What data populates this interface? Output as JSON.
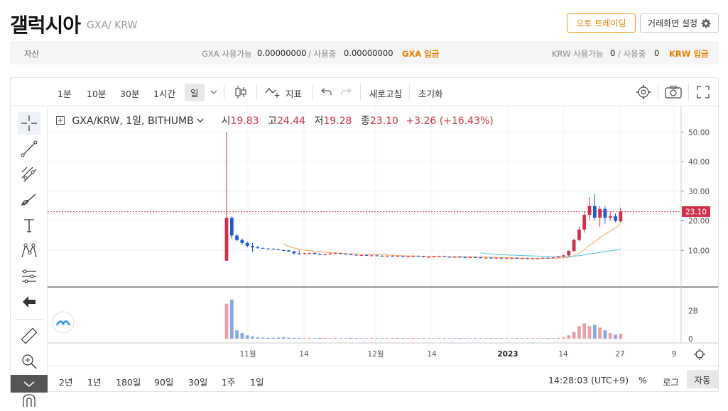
{
  "header": {
    "coin_name": "갤럭시아",
    "pair": "GXA/ KRW",
    "auto_trading": "오토 트레이딩",
    "trade_settings": "거래화면 설정"
  },
  "asset_bar": {
    "label": "자산",
    "gxa_available_label": "GXA 사용가능",
    "gxa_available": "0.00000000",
    "gxa_inuse_label": "/ 사용중",
    "gxa_inuse": "0.00000000",
    "gxa_deposit": "GXA 입금",
    "krw_available_label": "KRW 사용가능",
    "krw_available": "0",
    "krw_inuse_label": "/ 사용중",
    "krw_inuse": "0",
    "krw_deposit": "KRW 입금"
  },
  "toolbar": {
    "intervals": [
      "1분",
      "10분",
      "30분",
      "1시간",
      "일"
    ],
    "selected_interval": "일",
    "indicator": "지표",
    "refresh": "새로고침",
    "reset": "초기화"
  },
  "legend": {
    "symbol": "GXA/KRW, 1일, BITHUMB",
    "open_label": "시",
    "open": "19.83",
    "high_label": "고",
    "high": "24.44",
    "low_label": "저",
    "low": "19.28",
    "close_label": "종",
    "close": "23.10",
    "change": "+3.26 (+16.43%)"
  },
  "bottom_bar": {
    "ranges": [
      "2년",
      "1년",
      "180일",
      "90일",
      "30일",
      "1주",
      "1일"
    ],
    "time": "14:28:03 (UTC+9)",
    "percent": "%",
    "log": "로그",
    "auto": "자동"
  },
  "colors": {
    "up": "#d0304a",
    "down": "#1e5bd0",
    "accent": "#e67e00"
  },
  "chart_data": {
    "type": "candlestick",
    "current_price": "23.10",
    "y_ticks": [
      "50.00",
      "40.00",
      "30.00",
      "20.00",
      "10.00"
    ],
    "volume_ticks": [
      "2B",
      "0"
    ],
    "x_ticks": [
      "11월",
      "14",
      "12월",
      "14",
      "2023",
      "14",
      "27",
      "9"
    ],
    "ylim": [
      0,
      52
    ],
    "candles": [
      {
        "o": 6.5,
        "h": 50,
        "l": 6.5,
        "c": 21
      },
      {
        "o": 21,
        "h": 21.5,
        "l": 14,
        "c": 15
      },
      {
        "o": 15,
        "h": 15.5,
        "l": 13,
        "c": 13.5
      },
      {
        "o": 13.5,
        "h": 14,
        "l": 12,
        "c": 12.5
      },
      {
        "o": 12.5,
        "h": 13,
        "l": 11,
        "c": 11.5
      },
      {
        "o": 11.5,
        "h": 12.5,
        "l": 9.5,
        "c": 11
      },
      {
        "o": 11,
        "h": 11.5,
        "l": 10.5,
        "c": 10.8
      },
      {
        "o": 10.8,
        "h": 11,
        "l": 10.5,
        "c": 10.6
      },
      {
        "o": 10.6,
        "h": 10.8,
        "l": 10.3,
        "c": 10.5
      },
      {
        "o": 10.5,
        "h": 10.7,
        "l": 10.2,
        "c": 10.3
      },
      {
        "o": 10.3,
        "h": 10.5,
        "l": 10,
        "c": 10.1
      },
      {
        "o": 10.1,
        "h": 10.3,
        "l": 9.8,
        "c": 10.0
      },
      {
        "o": 10,
        "h": 10.2,
        "l": 9.5,
        "c": 9.6
      },
      {
        "o": 9.6,
        "h": 9.8,
        "l": 8.5,
        "c": 9.0
      },
      {
        "o": 9,
        "h": 10,
        "l": 8.5,
        "c": 8.8
      },
      {
        "o": 8.8,
        "h": 9.2,
        "l": 8.6,
        "c": 9.0
      },
      {
        "o": 9,
        "h": 9.3,
        "l": 8.8,
        "c": 9.1
      },
      {
        "o": 9.1,
        "h": 9.3,
        "l": 8.6,
        "c": 8.7
      },
      {
        "o": 8.7,
        "h": 9.0,
        "l": 8.3,
        "c": 8.5
      },
      {
        "o": 8.5,
        "h": 8.9,
        "l": 8.2,
        "c": 8.7
      },
      {
        "o": 8.7,
        "h": 9.1,
        "l": 8.5,
        "c": 8.9
      },
      {
        "o": 8.9,
        "h": 9.3,
        "l": 8.7,
        "c": 9.0
      },
      {
        "o": 9,
        "h": 9.2,
        "l": 8.7,
        "c": 8.8
      },
      {
        "o": 8.8,
        "h": 9.0,
        "l": 8.5,
        "c": 8.6
      },
      {
        "o": 8.6,
        "h": 8.9,
        "l": 8.4,
        "c": 8.5
      },
      {
        "o": 8.5,
        "h": 8.7,
        "l": 8.2,
        "c": 8.3
      },
      {
        "o": 8.3,
        "h": 8.6,
        "l": 8.1,
        "c": 8.4
      },
      {
        "o": 8.4,
        "h": 8.6,
        "l": 8.1,
        "c": 8.2
      },
      {
        "o": 8.2,
        "h": 8.5,
        "l": 8.0,
        "c": 8.3
      },
      {
        "o": 8.3,
        "h": 8.5,
        "l": 8.0,
        "c": 8.1
      },
      {
        "o": 8.1,
        "h": 8.4,
        "l": 7.9,
        "c": 8.0
      },
      {
        "o": 8,
        "h": 8.3,
        "l": 7.8,
        "c": 8.1
      },
      {
        "o": 8.1,
        "h": 8.3,
        "l": 7.8,
        "c": 7.9
      },
      {
        "o": 7.9,
        "h": 8.2,
        "l": 7.7,
        "c": 8.0
      },
      {
        "o": 8,
        "h": 8.2,
        "l": 7.7,
        "c": 7.8
      },
      {
        "o": 7.8,
        "h": 8.0,
        "l": 7.6,
        "c": 7.9
      },
      {
        "o": 7.9,
        "h": 8.3,
        "l": 7.7,
        "c": 8.1
      },
      {
        "o": 8.1,
        "h": 8.3,
        "l": 7.8,
        "c": 7.9
      },
      {
        "o": 7.9,
        "h": 8.1,
        "l": 7.6,
        "c": 7.7
      },
      {
        "o": 7.7,
        "h": 8.0,
        "l": 7.5,
        "c": 7.8
      },
      {
        "o": 7.8,
        "h": 8.1,
        "l": 7.6,
        "c": 7.9
      },
      {
        "o": 7.9,
        "h": 8.2,
        "l": 7.7,
        "c": 8.0
      },
      {
        "o": 8,
        "h": 8.2,
        "l": 7.7,
        "c": 7.8
      },
      {
        "o": 7.8,
        "h": 8.0,
        "l": 7.6,
        "c": 7.7
      },
      {
        "o": 7.7,
        "h": 8.0,
        "l": 7.5,
        "c": 7.8
      },
      {
        "o": 7.8,
        "h": 8.0,
        "l": 7.6,
        "c": 7.7
      },
      {
        "o": 7.7,
        "h": 7.9,
        "l": 7.4,
        "c": 7.6
      },
      {
        "o": 7.6,
        "h": 7.9,
        "l": 7.4,
        "c": 7.7
      },
      {
        "o": 7.7,
        "h": 7.9,
        "l": 7.5,
        "c": 7.6
      },
      {
        "o": 7.6,
        "h": 7.8,
        "l": 7.3,
        "c": 7.4
      },
      {
        "o": 7.4,
        "h": 7.7,
        "l": 7.2,
        "c": 7.5
      },
      {
        "o": 7.5,
        "h": 7.7,
        "l": 7.2,
        "c": 7.3
      },
      {
        "o": 7.3,
        "h": 7.6,
        "l": 7.1,
        "c": 7.4
      },
      {
        "o": 7.4,
        "h": 7.6,
        "l": 7.1,
        "c": 7.2
      },
      {
        "o": 7.2,
        "h": 7.5,
        "l": 7.0,
        "c": 7.3
      },
      {
        "o": 7.3,
        "h": 7.6,
        "l": 7.1,
        "c": 7.4
      },
      {
        "o": 7.4,
        "h": 7.6,
        "l": 7.1,
        "c": 7.2
      },
      {
        "o": 7.2,
        "h": 7.5,
        "l": 7.0,
        "c": 7.3
      },
      {
        "o": 7.3,
        "h": 7.5,
        "l": 7.0,
        "c": 7.1
      },
      {
        "o": 7.1,
        "h": 7.4,
        "l": 6.9,
        "c": 7.2
      },
      {
        "o": 7.2,
        "h": 7.5,
        "l": 7.0,
        "c": 7.3
      },
      {
        "o": 7.3,
        "h": 7.6,
        "l": 7.1,
        "c": 7.5
      },
      {
        "o": 7.5,
        "h": 7.8,
        "l": 7.2,
        "c": 7.4
      },
      {
        "o": 7.4,
        "h": 7.7,
        "l": 7.2,
        "c": 7.6
      },
      {
        "o": 7.6,
        "h": 8.0,
        "l": 7.4,
        "c": 7.9
      },
      {
        "o": 7.9,
        "h": 8.5,
        "l": 7.6,
        "c": 8.3
      },
      {
        "o": 8.3,
        "h": 10,
        "l": 8.0,
        "c": 9.8
      },
      {
        "o": 9.8,
        "h": 14,
        "l": 9.5,
        "c": 13.5
      },
      {
        "o": 13.5,
        "h": 18,
        "l": 13,
        "c": 17
      },
      {
        "o": 17,
        "h": 23,
        "l": 16,
        "c": 22
      },
      {
        "o": 22,
        "h": 28,
        "l": 20,
        "c": 25
      },
      {
        "o": 25,
        "h": 29,
        "l": 20,
        "c": 21
      },
      {
        "o": 21,
        "h": 25,
        "l": 18,
        "c": 24
      },
      {
        "o": 24,
        "h": 25,
        "l": 19,
        "c": 21
      },
      {
        "o": 21,
        "h": 23,
        "l": 20,
        "c": 21.5
      },
      {
        "o": 21.5,
        "h": 22.5,
        "l": 19.5,
        "c": 20
      },
      {
        "o": 19.83,
        "h": 24.44,
        "l": 19.28,
        "c": 23.1
      }
    ],
    "volumes": [
      1.25,
      1.4,
      0.3,
      0.2,
      0.12,
      0.08,
      0.05,
      0.04,
      0.03,
      0.03,
      0.04,
      0.05,
      0.04,
      0.03,
      0.03,
      0.02,
      0.03,
      0.02,
      0.03,
      0.03,
      0.02,
      0.03,
      0.02,
      0.02,
      0.03,
      0.02,
      0.02,
      0.02,
      0.03,
      0.02,
      0.02,
      0.02,
      0.02,
      0.03,
      0.02,
      0.02,
      0.03,
      0.02,
      0.02,
      0.02,
      0.02,
      0.03,
      0.02,
      0.02,
      0.02,
      0.02,
      0.02,
      0.02,
      0.02,
      0.02,
      0.02,
      0.02,
      0.02,
      0.02,
      0.02,
      0.02,
      0.02,
      0.02,
      0.02,
      0.02,
      0.02,
      0.02,
      0.02,
      0.02,
      0.03,
      0.05,
      0.12,
      0.25,
      0.45,
      0.55,
      0.45,
      0.5,
      0.4,
      0.3,
      0.2,
      0.15,
      0.18
    ]
  }
}
